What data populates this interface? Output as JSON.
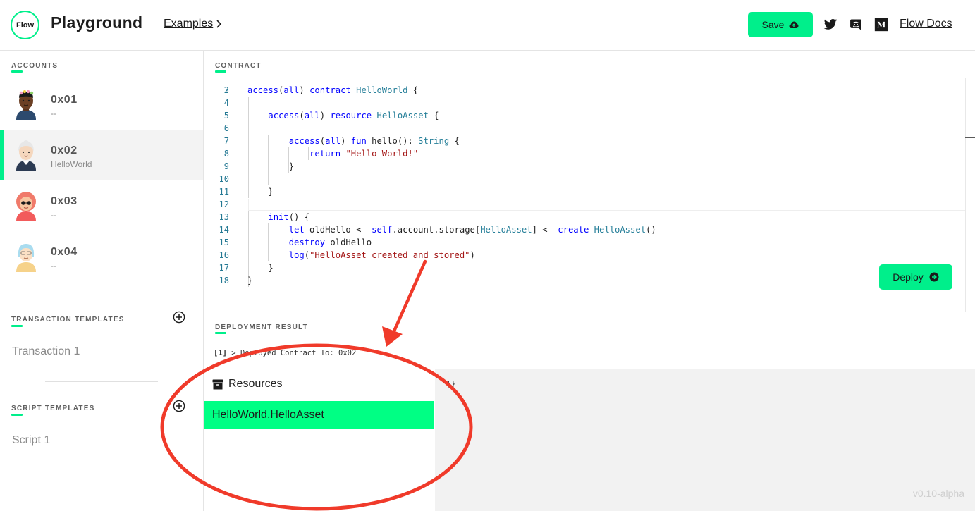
{
  "header": {
    "logo_text": "Flow",
    "title": "Playground",
    "examples_label": "Examples",
    "save_label": "Save",
    "docs_label": "Flow Docs",
    "icons": [
      "twitter-icon",
      "discord-icon",
      "medium-icon"
    ]
  },
  "sidebar": {
    "accounts_label": "ACCOUNTS",
    "accounts": [
      {
        "address": "0x01",
        "contract": "--",
        "selected": false
      },
      {
        "address": "0x02",
        "contract": "HelloWorld",
        "selected": true
      },
      {
        "address": "0x03",
        "contract": "--",
        "selected": false
      },
      {
        "address": "0x04",
        "contract": "--",
        "selected": false
      }
    ],
    "transaction_templates_label": "TRANSACTION TEMPLATES",
    "transactions": [
      "Transaction 1"
    ],
    "script_templates_label": "SCRIPT TEMPLATES",
    "scripts": [
      "Script 1"
    ]
  },
  "editor": {
    "label": "CONTRACT",
    "partial_first_line_number": "2",
    "lines": [
      {
        "n": "3",
        "text": "access(all) contract HelloWorld {"
      },
      {
        "n": "4",
        "text": ""
      },
      {
        "n": "5",
        "text": "    access(all) resource HelloAsset {"
      },
      {
        "n": "6",
        "text": ""
      },
      {
        "n": "7",
        "text": "        access(all) fun hello(): String {"
      },
      {
        "n": "8",
        "text": "            return \"Hello World!\""
      },
      {
        "n": "9",
        "text": "        }"
      },
      {
        "n": "10",
        "text": ""
      },
      {
        "n": "11",
        "text": "    }"
      },
      {
        "n": "12",
        "text": ""
      },
      {
        "n": "13",
        "text": "    init() {"
      },
      {
        "n": "14",
        "text": "        let oldHello <- self.account.storage[HelloAsset] <- create HelloAsset()"
      },
      {
        "n": "15",
        "text": "        destroy oldHello"
      },
      {
        "n": "16",
        "text": "        log(\"HelloAsset created and stored\")"
      },
      {
        "n": "17",
        "text": "    }"
      },
      {
        "n": "18",
        "text": "}"
      }
    ],
    "deploy_label": "Deploy"
  },
  "deployment_result": {
    "label": "DEPLOYMENT RESULT",
    "entries": [
      {
        "index": "[1]",
        "message": "Deployed Contract To: 0x02"
      }
    ]
  },
  "resources": {
    "title": "Resources",
    "items": [
      "HelloWorld.HelloAsset"
    ],
    "storage_value": "{}"
  },
  "version": "v0.10-alpha",
  "colors": {
    "accent": "#00ef8b",
    "annotation": "#f03a2a",
    "keyword": "#0000ff",
    "type": "#267f99",
    "string": "#a31515",
    "line_number": "#237893"
  }
}
